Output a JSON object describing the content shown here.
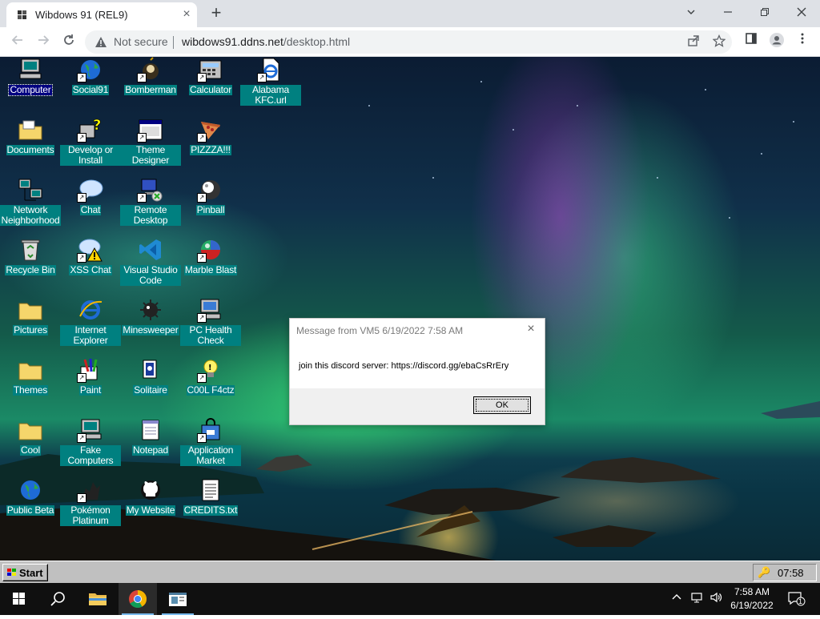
{
  "browser": {
    "tab_title": "Wibdows 91 (REL9)",
    "tab_close": "×",
    "new_tab": "+",
    "not_secure": "Not secure",
    "url_domain": "wibdows91.ddns.net",
    "url_path": "/desktop.html"
  },
  "desktop": {
    "icons": [
      {
        "label": "Computer",
        "icon": "computer-icon"
      },
      {
        "label": "Social91",
        "icon": "globe-icon"
      },
      {
        "label": "Bomberman",
        "icon": "bomberman-icon"
      },
      {
        "label": "Calculator",
        "icon": "calculator-icon"
      },
      {
        "label": "Alabama KFC.url",
        "icon": "ie-url-icon"
      },
      {
        "label": "Documents",
        "icon": "documents-folder-icon"
      },
      {
        "label": "Develop or Install",
        "icon": "help-icon"
      },
      {
        "label": "Theme Designer",
        "icon": "window-icon"
      },
      {
        "label": "PIZZZA!!!",
        "icon": "pizza-icon"
      },
      {
        "label": "Network Neighborhood",
        "icon": "network-icon"
      },
      {
        "label": "Chat",
        "icon": "chat-bubble-icon"
      },
      {
        "label": "Remote Desktop",
        "icon": "remote-desktop-icon"
      },
      {
        "label": "Pinball",
        "icon": "pinball-icon"
      },
      {
        "label": "Recycle Bin",
        "icon": "recycle-bin-icon"
      },
      {
        "label": "XSS Chat",
        "icon": "warning-chat-icon"
      },
      {
        "label": "Visual Studio Code",
        "icon": "vscode-icon"
      },
      {
        "label": "Marble Blast",
        "icon": "marble-icon"
      },
      {
        "label": "Pictures",
        "icon": "folder-icon"
      },
      {
        "label": "Internet Explorer",
        "icon": "internet-explorer-icon"
      },
      {
        "label": "Minesweeper",
        "icon": "mine-icon"
      },
      {
        "label": "PC Health Check",
        "icon": "pc-health-icon"
      },
      {
        "label": "Themes",
        "icon": "folder-icon"
      },
      {
        "label": "Paint",
        "icon": "paint-icon"
      },
      {
        "label": "Solitaire",
        "icon": "cards-icon"
      },
      {
        "label": "C00L F4ctz",
        "icon": "lightbulb-icon"
      },
      {
        "label": "Cool",
        "icon": "folder-icon"
      },
      {
        "label": "Fake Computers",
        "icon": "computer-icon"
      },
      {
        "label": "Notepad",
        "icon": "notepad-icon"
      },
      {
        "label": "Application Market",
        "icon": "market-bag-icon"
      },
      {
        "label": "Public Beta",
        "icon": "globe-icon"
      },
      {
        "label": "Pokémon Platinum",
        "icon": "pokemon-icon"
      },
      {
        "label": "My Website",
        "icon": "github-icon"
      },
      {
        "label": "CREDITS.txt",
        "icon": "text-file-icon"
      }
    ]
  },
  "dialog": {
    "title": "Message from VM5 6/19/2022 7:58 AM",
    "close": "×",
    "message": "join this discord server: https://discord.gg/ebaCsRrEry",
    "ok_label": "OK"
  },
  "w9taskbar": {
    "start_label": "Start",
    "clock": "07:58"
  },
  "w10taskbar": {
    "time": "7:58 AM",
    "date": "6/19/2022",
    "notification_count": "1"
  },
  "colors": {
    "icon_label_bg": "#008080",
    "selected_label_bg": "#000080",
    "taskbar_gray": "#c0c0c0"
  }
}
